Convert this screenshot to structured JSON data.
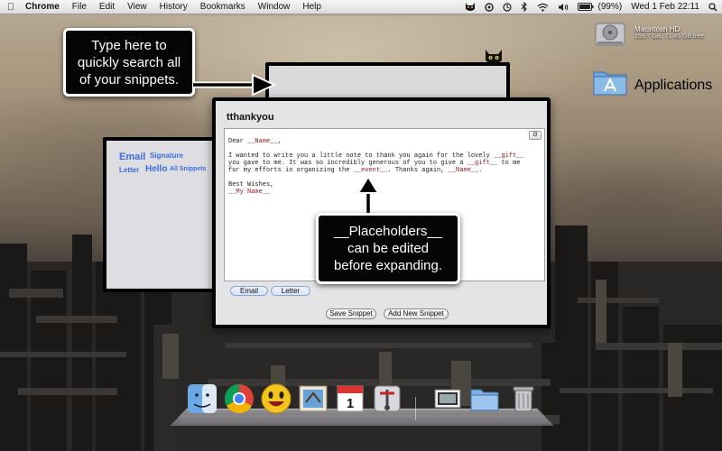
{
  "menubar": {
    "app_name": "Chrome",
    "items": [
      "File",
      "Edit",
      "View",
      "History",
      "Bookmarks",
      "Window",
      "Help"
    ],
    "battery": "(99%)",
    "clock": "Wed 1 Feb  22:11"
  },
  "desktop": {
    "drive_label": "Macintosh HD",
    "drive_sublabel": "159.7 GB, 71.45 GB free",
    "apps_label": "Applications"
  },
  "callouts": {
    "search_tip": [
      "Type here to",
      "quickly search all",
      "of your snippets."
    ],
    "placeholder_tip": [
      "__Placeholders__",
      "can be edited",
      "before expanding."
    ]
  },
  "side_panel": {
    "tags": [
      "Email",
      "Signature",
      "Letter",
      "Hello",
      "All Snippets"
    ]
  },
  "snippet": {
    "title": "tthankyou",
    "gear_label": "⚙",
    "lines": [
      [
        {
          "t": "Dear "
        },
        {
          "t": "__Name__",
          "ph": true
        },
        {
          "t": ","
        }
      ],
      [
        {
          "t": ""
        }
      ],
      [
        {
          "t": "I wanted to write you a little note to thank you again for the lovely "
        },
        {
          "t": "__gift__",
          "ph": true
        }
      ],
      [
        {
          "t": "you gave to me. It was so incredibly generous of you to give a "
        },
        {
          "t": "__gift__",
          "ph": true
        },
        {
          "t": " to me"
        }
      ],
      [
        {
          "t": "for my efforts in organizing the "
        },
        {
          "t": "__event__",
          "ph": true
        },
        {
          "t": ". Thanks again, "
        },
        {
          "t": "__Name__",
          "ph": true
        },
        {
          "t": "."
        }
      ],
      [
        {
          "t": ""
        }
      ],
      [
        {
          "t": "Best Wishes,"
        }
      ],
      [
        {
          "t": "__My Name__",
          "ph": true
        }
      ]
    ],
    "tags": [
      "Email",
      "Letter"
    ],
    "save_label": "Save Snippet",
    "add_label": "Add New Snippet"
  },
  "colors": {
    "tag_blue": "#3b6ee0",
    "placeholder_red": "#8a1a1a"
  }
}
